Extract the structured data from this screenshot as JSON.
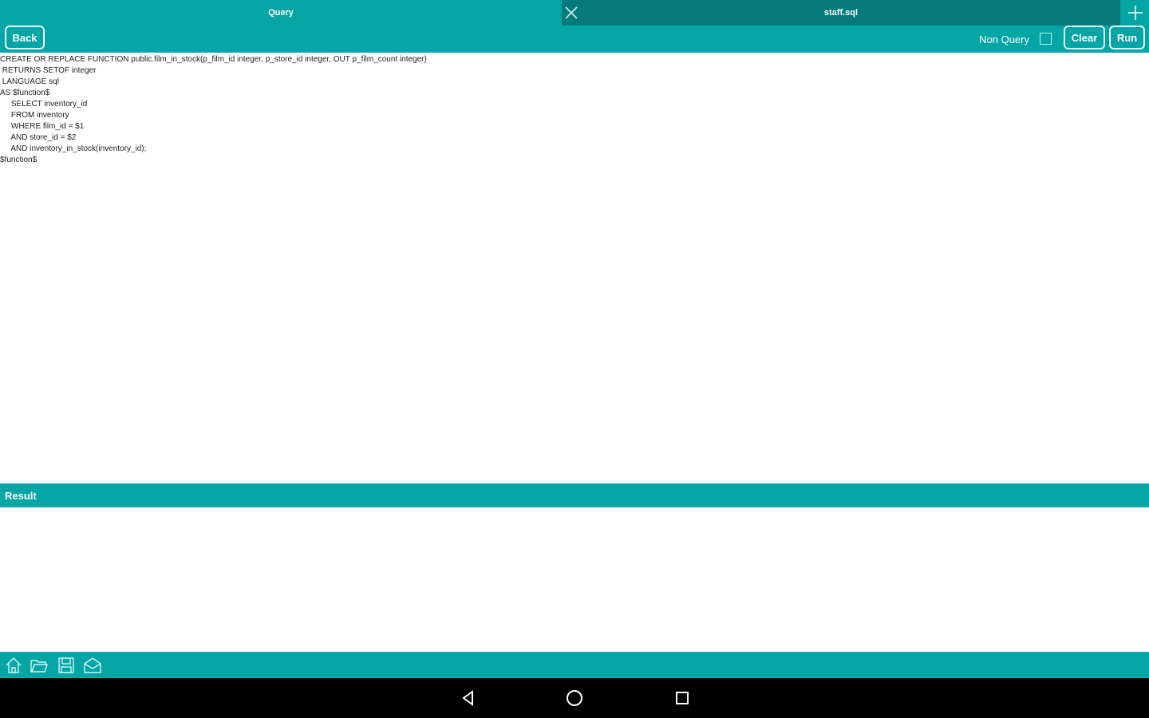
{
  "tabs": [
    {
      "label": "Query"
    },
    {
      "label": "staff.sql"
    }
  ],
  "toolbar": {
    "back_label": "Back",
    "nonquery_label": "Non Query",
    "nonquery_checked": false,
    "clear_label": "Clear",
    "run_label": "Run"
  },
  "editor": {
    "lines": [
      "CREATE OR REPLACE FUNCTION public.film_in_stock(p_film_id integer, p_store_id integer, OUT p_film_count integer)",
      " RETURNS SETOF integer",
      " LANGUAGE sql",
      "AS $function$",
      "     SELECT inventory_id",
      "     FROM inventory",
      "     WHERE film_id = $1",
      "     AND store_id = $2",
      "     AND inventory_in_stock(inventory_id);",
      "$function$"
    ]
  },
  "result": {
    "header": "Result"
  },
  "colors": {
    "accent": "#05a5a5",
    "accent_dark": "#047a7a",
    "navbar": "#000000"
  },
  "icons": {
    "tab_close": "close-icon",
    "tab_add": "plus-icon",
    "bottom": [
      "home-icon",
      "folder-open-icon",
      "save-icon",
      "mail-icon"
    ],
    "nav": [
      "back-triangle-icon",
      "home-circle-icon",
      "recents-square-icon"
    ]
  }
}
